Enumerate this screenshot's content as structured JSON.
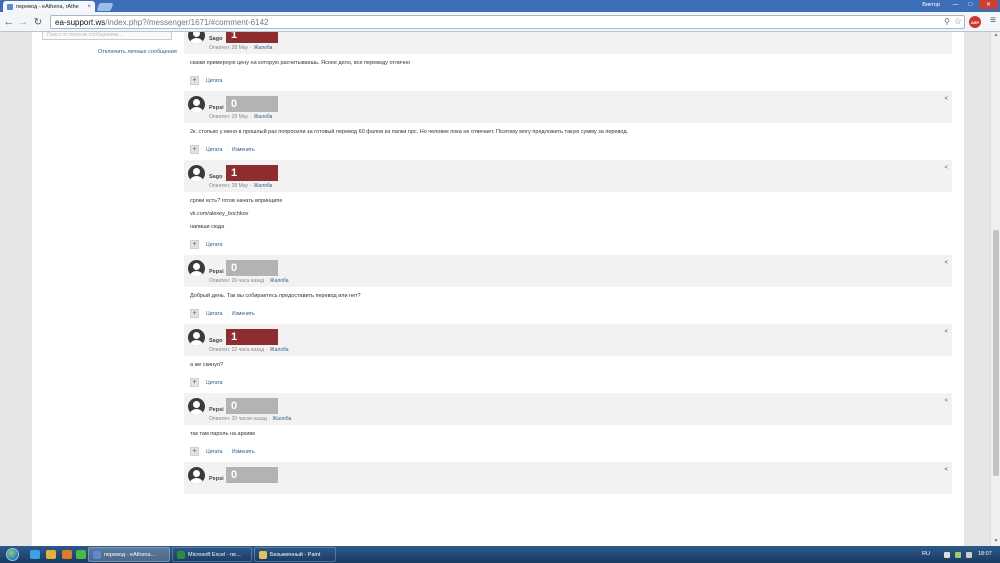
{
  "browser": {
    "tab_title": "перевод - eAthena, rAthe",
    "tab_close": "×",
    "user_name": "Виктор",
    "win_min": "—",
    "win_max": "□",
    "win_close": "✕",
    "url_host": "ea-support.ws",
    "url_path": "/index.php?/messenger/1671/#comment-6142",
    "abp_label": "ABP"
  },
  "sidebar": {
    "search_placeholder": "Поиск по личным сообщениям...",
    "disable_pm_link": "Отключить личные сообщения"
  },
  "messages": [
    {
      "author": "Sago",
      "rating": "1",
      "rating_type": "pos",
      "meta_prefix": "Опиатен:",
      "date": "28 May",
      "report": "Жалоба",
      "lines": [
        "скажи примерную цену на которую расчитываешь. Ясное дело, все переведу отлично"
      ],
      "quote": "Цитата",
      "edit": ""
    },
    {
      "author": "Pepsi",
      "rating": "0",
      "rating_type": "zero",
      "meta_prefix": "Опиатен:",
      "date": "28 May",
      "report": "Жалоба",
      "lines": [
        "2к. столько у меня в прошлый раз попросили за готовый перевод 60 фалов из папки npc. Но человек пока не отвечает. Поэтому могу предложить такую сумму за перевод."
      ],
      "quote": "Цитата",
      "edit": "Изменить"
    },
    {
      "author": "Sago",
      "rating": "1",
      "rating_type": "pos",
      "meta_prefix": "Опиатен:",
      "date": "28 May",
      "report": "Жалоба",
      "lines": [
        "сроки есть? готов начать впринципе",
        "vk.com/alexey_bochkov",
        "напиши сюда"
      ],
      "quote": "Цитата",
      "edit": ""
    },
    {
      "author": "Pepsi",
      "rating": "0",
      "rating_type": "zero",
      "meta_prefix": "Опиатен:",
      "date": "20 часа назад",
      "report": "Жалоба",
      "lines": [
        "Добрый день. Так вы собираетесь предоставить перевод или нет?"
      ],
      "quote": "Цитата",
      "edit": "Изменить"
    },
    {
      "author": "Sago",
      "rating": "1",
      "rating_type": "pos",
      "meta_prefix": "Опиатен:",
      "date": "22 часа назад",
      "report": "Жалоба",
      "lines": [
        "а же скинул?"
      ],
      "quote": "Цитата",
      "edit": ""
    },
    {
      "author": "Pepsi",
      "rating": "0",
      "rating_type": "zero",
      "meta_prefix": "Опиатен:",
      "date": "20 часов назад",
      "report": "Жалоба",
      "lines": [
        "так там пароль на архиве"
      ],
      "quote": "Цитата",
      "edit": "Изменить"
    },
    {
      "author": "Pepsi",
      "rating": "0",
      "rating_type": "zero",
      "meta_prefix": "",
      "date": "",
      "report": "",
      "lines": [],
      "quote": "",
      "edit": ""
    }
  ],
  "taskbar": {
    "tasks": [
      "перевод - eAthena...",
      "Microsoft Excel - пе...",
      "Безымянный - Paint"
    ],
    "lang": "RU",
    "clock": "18:07"
  },
  "icons": {
    "share": "share-icon",
    "search": "search-icon",
    "star": "star-icon"
  },
  "colors": {
    "rating_positive": "#8e2d2d",
    "rating_zero": "#b3b3b3",
    "link": "#2c5d8a"
  }
}
